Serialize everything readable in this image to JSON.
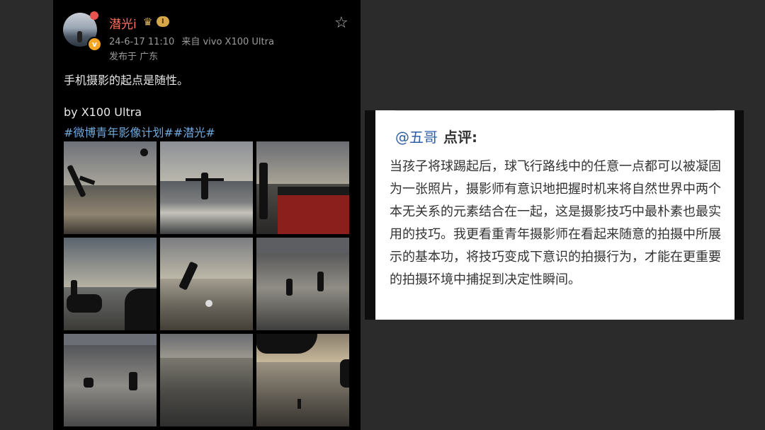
{
  "post": {
    "username": "潜光i",
    "level_badge": "I",
    "time": "24-6-17 11:10",
    "source": "来自 vivo X100 Ultra",
    "location": "发布于 广东",
    "text": "手机摄影的起点是随性。",
    "by_line": "by X100 Ultra",
    "hashtags": "#微博青年影像计划##潜光#",
    "avatar_icon": "avatar-photo",
    "verify_icon": "verified-badge",
    "star_icon": "star-outline",
    "photos_count": 9
  },
  "review": {
    "name": "@五哥",
    "label": "点评:",
    "body": "当孩子将球踢起后，球飞行路线中的任意一点都可以被凝固为一张照片，摄影师有意识地把握时机来将自然世界中两个本无关系的元素结合在一起，这是摄影技巧中最朴素也最实用的技巧。我更看重青年摄影师在看起来随意的拍摄中所展示的基本功，将技巧变成下意识的拍摄行为，才能在更重要的拍摄环境中捕捉到决定性瞬间。"
  },
  "colors": {
    "page_bg": "#2b2b2b",
    "phone_bg": "#000000",
    "username": "#ff6f5b",
    "hashtag": "#6fa8dc",
    "review_name": "#2f5fa8"
  }
}
